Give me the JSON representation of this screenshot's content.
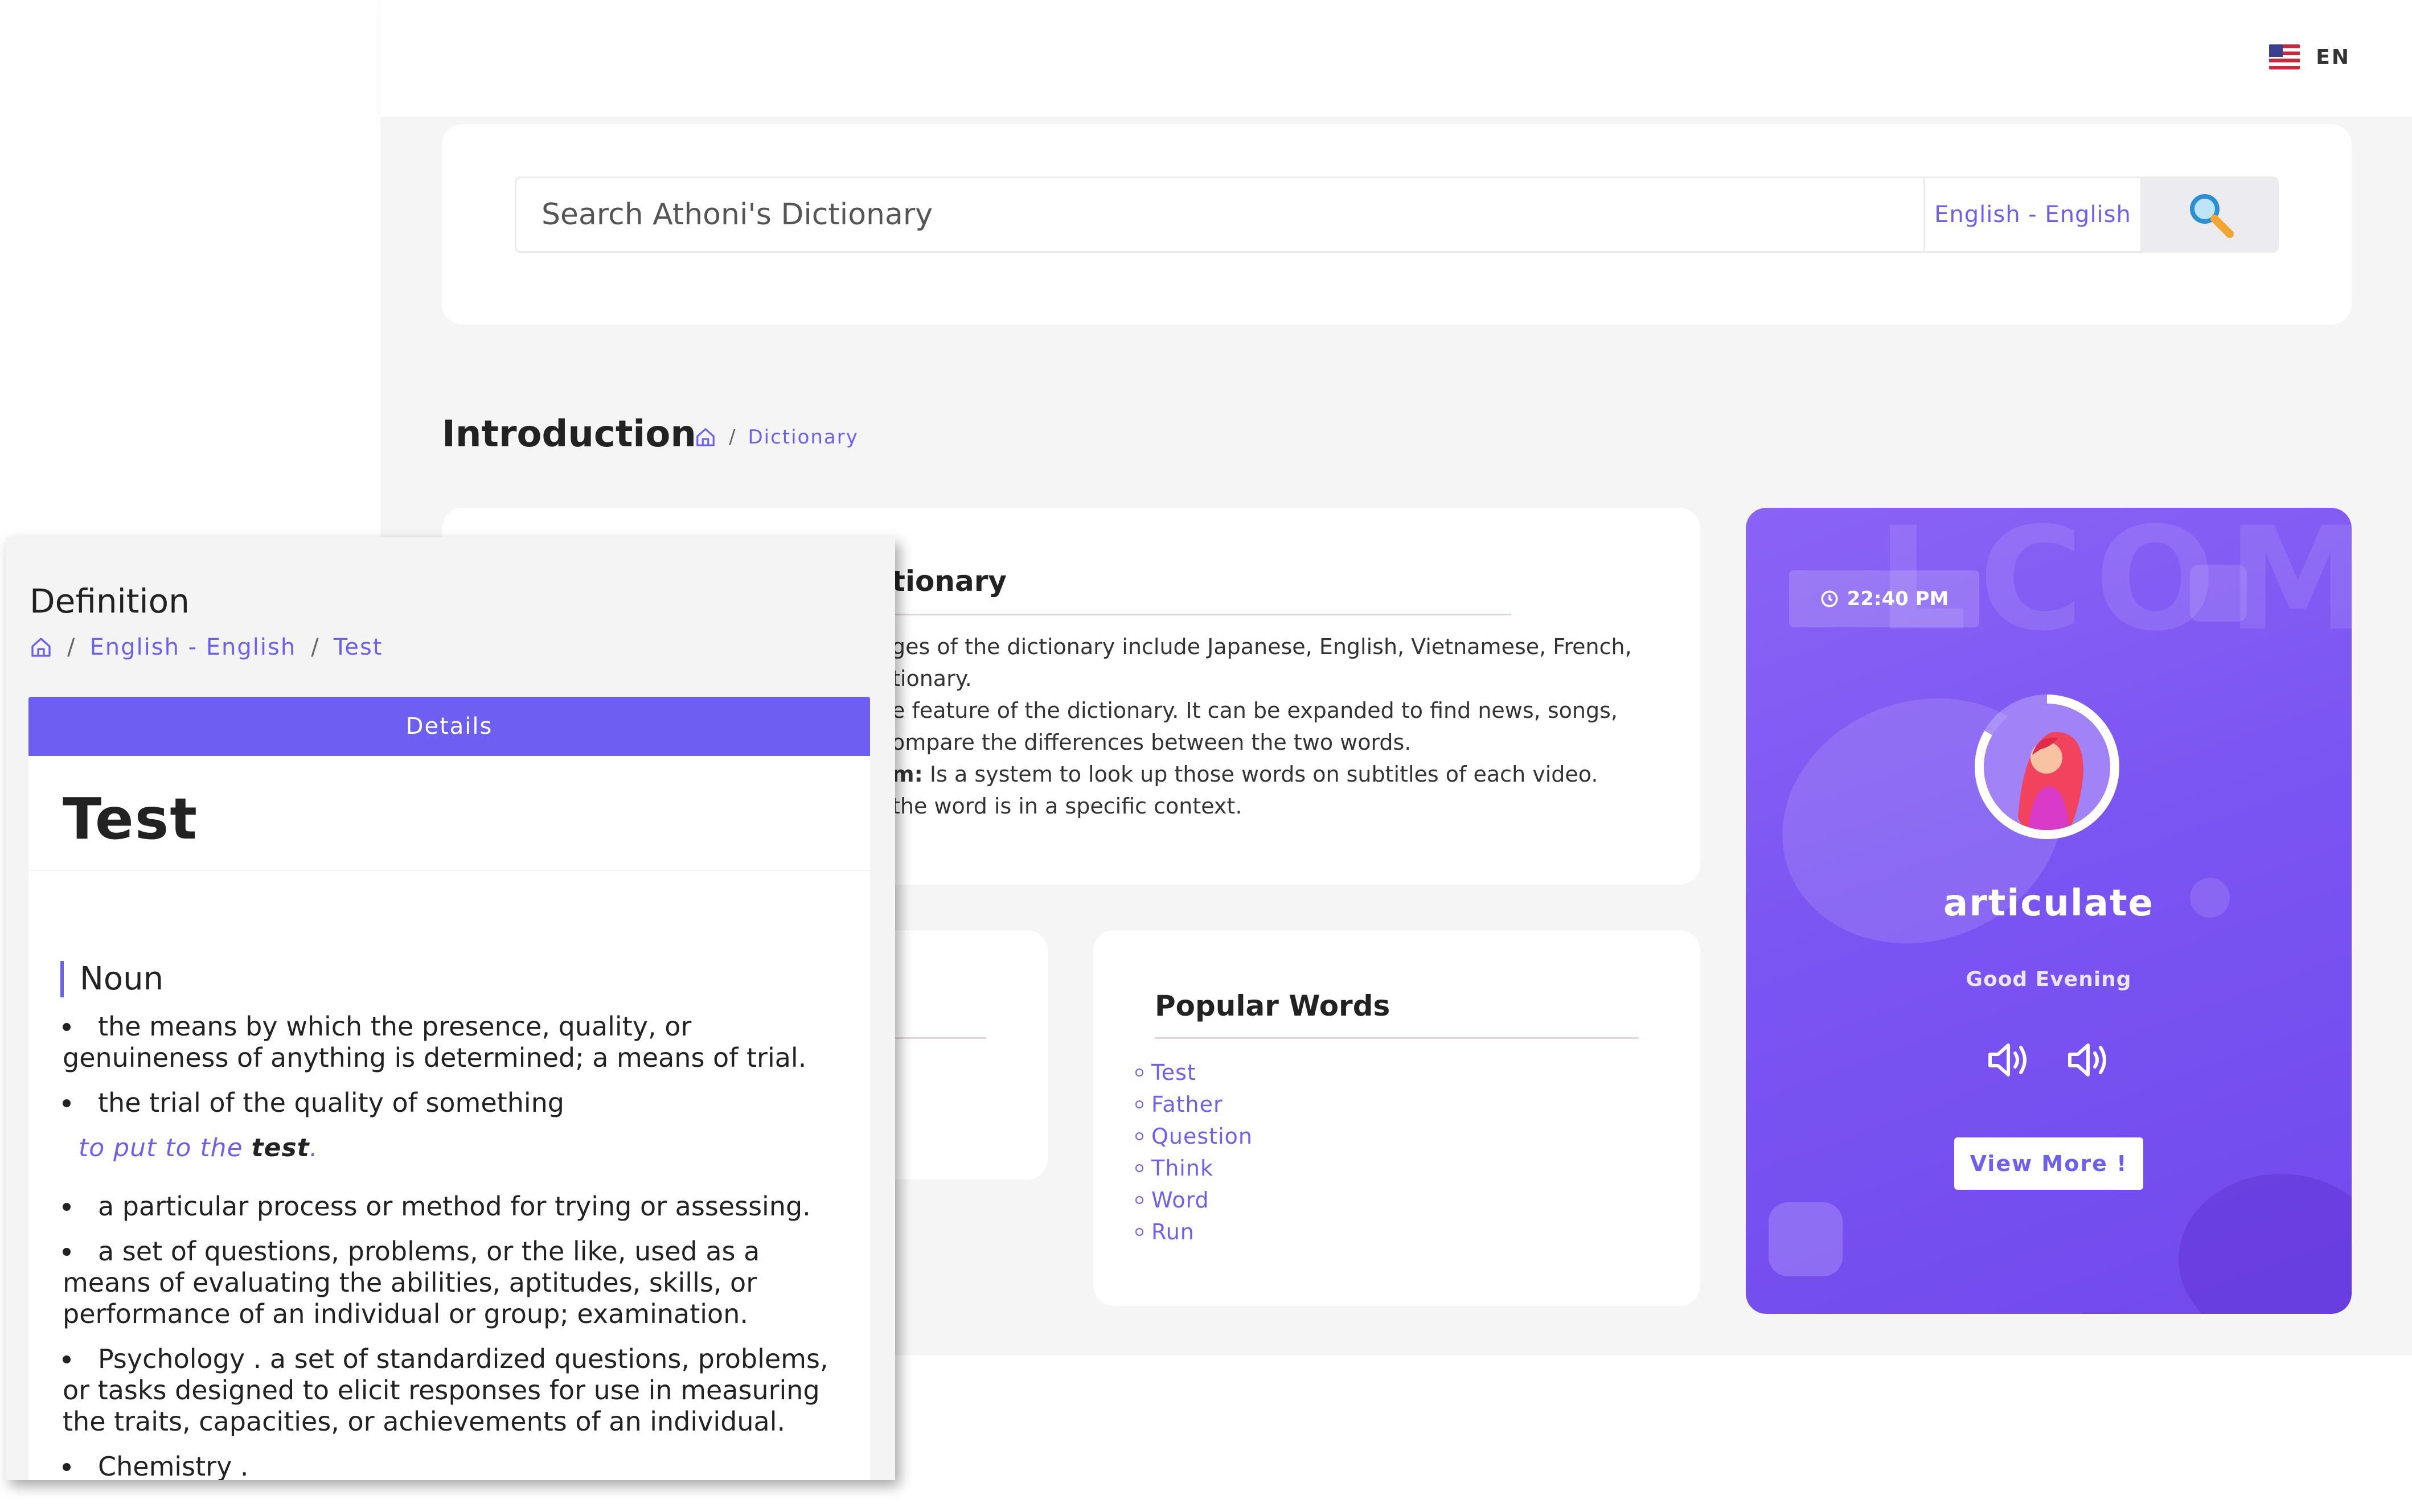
{
  "header": {
    "language_code": "EN",
    "flag_icon": "us-flag-icon"
  },
  "search": {
    "placeholder": "Search Athoni's Dictionary",
    "language_pair": "English - English",
    "button_icon": "search-icon"
  },
  "page": {
    "title": "Introduction",
    "breadcrumb": [
      "Dictionary"
    ]
  },
  "intro_card": {
    "heading_visible": "tionary",
    "lines": [
      "ges of the dictionary include Japanese, English, Vietnamese, French,",
      "tionary.",
      "e feature of the dictionary. It can be expanded to find news, songs,",
      "ompare the differences between the two words.",
      "Is a system to look up those words on subtitles of each video.",
      "the word is in a specific context."
    ],
    "bold_fragment": "m:"
  },
  "popular_words": {
    "title": "Popular Words",
    "items": [
      "Test",
      "Father",
      "Question",
      "Think",
      "Word",
      "Run"
    ]
  },
  "welcome_card": {
    "time": "22:40 PM",
    "word": "articulate",
    "greeting": "Good Evening",
    "view_more_label": "View More !",
    "accent_color": "#7b55f2"
  },
  "definition_panel": {
    "title": "Definition",
    "breadcrumb": [
      "English - English",
      "Test"
    ],
    "details_label": "Details",
    "word": "Test",
    "part_of_speech": "Noun",
    "senses": [
      "the means by which the presence, quality, or genuineness of anything is determined; a means of trial.",
      "the trial of the quality of something",
      "a particular process or method for trying or assessing.",
      "a set of questions, problems, or the like, used as a means of evaluating the abilities, aptitudes, skills, or performance of an individual or group; examination.",
      "Psychology . a set of standardized questions, problems, or tasks designed to elicit responses for use in measuring the traits, capacities, or achievements of an individual.",
      "Chemistry ."
    ],
    "example_prefix": "to put to the",
    "example_word": "test",
    "example_suffix": "."
  },
  "colors": {
    "primary": "#6d5ff2",
    "background": "#f5f5f6"
  }
}
